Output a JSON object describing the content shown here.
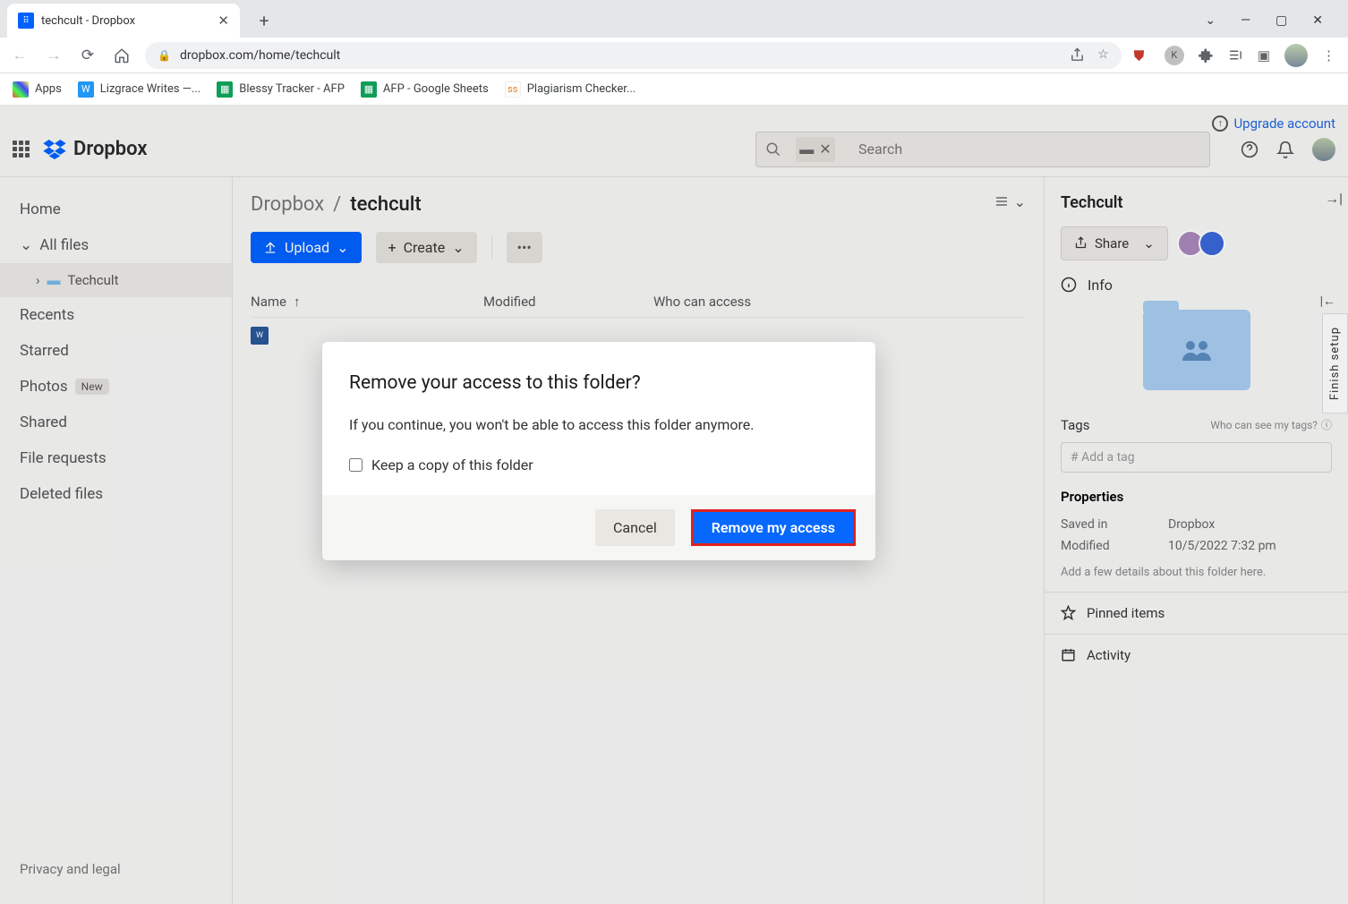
{
  "browser": {
    "tab_title": "techcult - Dropbox",
    "url": "dropbox.com/home/techcult",
    "bookmarks": [
      {
        "label": "Apps",
        "color": "#fff"
      },
      {
        "label": "Lizgrace Writes —...",
        "color": "#2196f3"
      },
      {
        "label": "Blessy Tracker - AFP",
        "color": "#0f9d58"
      },
      {
        "label": "AFP - Google Sheets",
        "color": "#0f9d58"
      },
      {
        "label": "Plagiarism Checker...",
        "color": "#e67e22"
      }
    ]
  },
  "app": {
    "upgrade_label": "Upgrade account",
    "brand": "Dropbox",
    "search_placeholder": "Search",
    "sidebar": {
      "items": [
        {
          "label": "Home"
        },
        {
          "label": "All files"
        },
        {
          "label": "Techcult"
        },
        {
          "label": "Recents"
        },
        {
          "label": "Starred"
        },
        {
          "label": "Photos",
          "badge": "New"
        },
        {
          "label": "Shared"
        },
        {
          "label": "File requests"
        },
        {
          "label": "Deleted files"
        }
      ],
      "footer": "Privacy and legal"
    },
    "breadcrumb": {
      "root": "Dropbox",
      "current": "techcult"
    },
    "actions": {
      "upload": "Upload",
      "create": "Create"
    },
    "columns": {
      "name": "Name",
      "modified": "Modified",
      "access": "Who can access"
    },
    "panel": {
      "title": "Techcult",
      "share": "Share",
      "info": "Info",
      "tags": "Tags",
      "tags_sub": "Who can see my tags?",
      "tag_placeholder": "# Add a tag",
      "properties": "Properties",
      "props": [
        {
          "key": "Saved in",
          "val": "Dropbox"
        },
        {
          "key": "Modified",
          "val": "10/5/2022 7:32 pm"
        }
      ],
      "details": "Add a few details about this folder here.",
      "pinned": "Pinned items",
      "activity": "Activity"
    },
    "side_tab": "Finish setup"
  },
  "modal": {
    "title": "Remove your access to this folder?",
    "text": "If you continue, you won't be able to access this folder anymore.",
    "checkbox": "Keep a copy of this folder",
    "cancel": "Cancel",
    "confirm": "Remove my access"
  }
}
